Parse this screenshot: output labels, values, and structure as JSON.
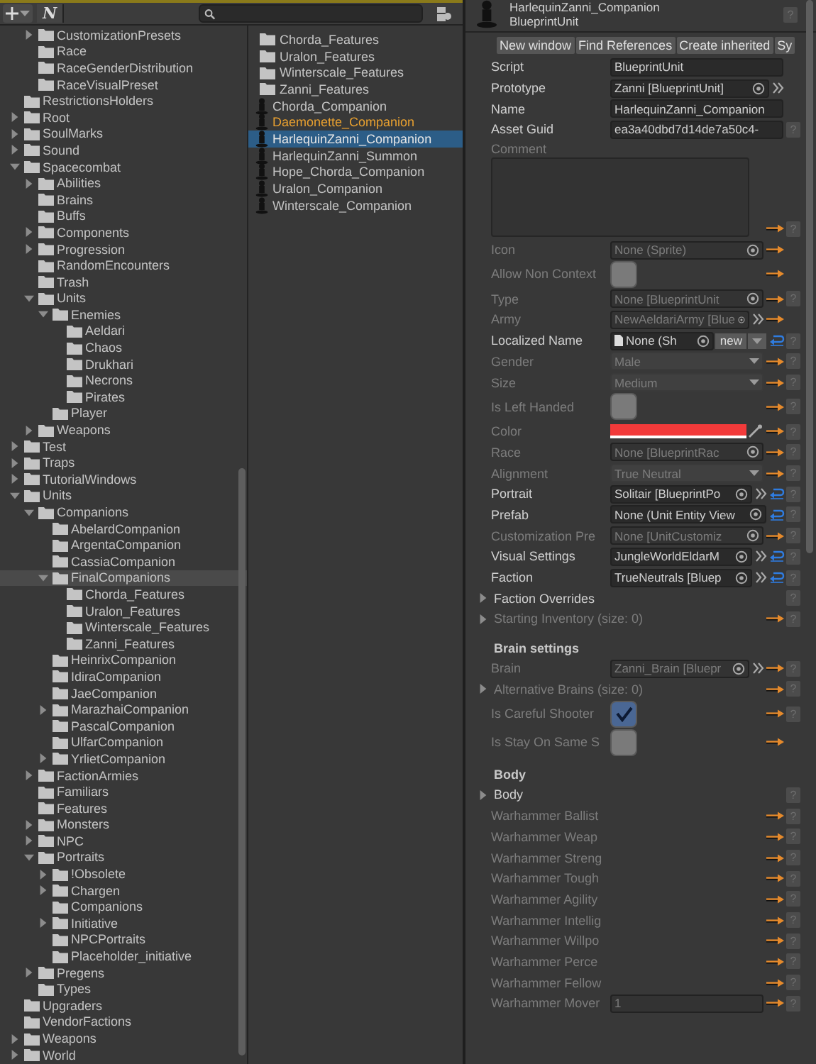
{
  "toolbar": {
    "logo": "N"
  },
  "tree": {
    "continued_items": [
      {
        "label": "CustomizationPresets",
        "expanded": false,
        "selected": false
      },
      {
        "label": "Race",
        "selected": false
      },
      {
        "label": "RaceGenderDistribution",
        "selected": false
      },
      {
        "label": "RaceVisualPreset",
        "selected": false
      }
    ],
    "items": [
      {
        "label": "RestrictionsHolders",
        "selected": false
      },
      {
        "label": "Root",
        "expanded": false,
        "selected": false
      },
      {
        "label": "SoulMarks",
        "expanded": false,
        "selected": false
      },
      {
        "label": "Sound",
        "expanded": false,
        "selected": false
      },
      {
        "label": "Spacecombat",
        "expanded": true,
        "selected": false,
        "children": [
          {
            "label": "Abilities",
            "expanded": false,
            "selected": false
          },
          {
            "label": "Brains",
            "selected": false
          },
          {
            "label": "Buffs",
            "selected": false
          },
          {
            "label": "Components",
            "expanded": false,
            "selected": false
          },
          {
            "label": "Progression",
            "expanded": false,
            "selected": false
          },
          {
            "label": "RandomEncounters",
            "selected": false
          },
          {
            "label": "Trash",
            "selected": false
          },
          {
            "label": "Units",
            "expanded": true,
            "selected": false,
            "children": [
              {
                "label": "Enemies",
                "expanded": true,
                "selected": false,
                "children": [
                  {
                    "label": "Aeldari",
                    "selected": false
                  },
                  {
                    "label": "Chaos",
                    "selected": false
                  },
                  {
                    "label": "Drukhari",
                    "selected": false
                  },
                  {
                    "label": "Necrons",
                    "selected": false
                  },
                  {
                    "label": "Pirates",
                    "selected": false
                  }
                ]
              },
              {
                "label": "Player",
                "selected": false
              }
            ]
          },
          {
            "label": "Weapons",
            "expanded": false,
            "selected": false
          }
        ]
      },
      {
        "label": "Test",
        "expanded": false,
        "selected": false
      },
      {
        "label": "Traps",
        "expanded": false,
        "selected": false
      },
      {
        "label": "TutorialWindows",
        "expanded": false,
        "selected": false
      },
      {
        "label": "Units",
        "expanded": true,
        "selected": false,
        "children": [
          {
            "label": "Companions",
            "expanded": true,
            "selected": false,
            "children": [
              {
                "label": "AbelardCompanion",
                "selected": false
              },
              {
                "label": "ArgentaCompanion",
                "selected": false
              },
              {
                "label": "CassiaCompanion",
                "selected": false
              },
              {
                "label": "FinalCompanions",
                "expanded": true,
                "selected": true,
                "children": [
                  {
                    "label": "Chorda_Features",
                    "selected": false
                  },
                  {
                    "label": "Uralon_Features",
                    "selected": false
                  },
                  {
                    "label": "Winterscale_Features",
                    "selected": false
                  },
                  {
                    "label": "Zanni_Features",
                    "selected": false
                  }
                ]
              },
              {
                "label": "HeinrixCompanion",
                "selected": false
              },
              {
                "label": "IdiraCompanion",
                "selected": false
              },
              {
                "label": "JaeCompanion",
                "selected": false
              },
              {
                "label": "MarazhaiCompanion",
                "expanded": false,
                "selected": false
              },
              {
                "label": "PascalCompanion",
                "selected": false
              },
              {
                "label": "UlfarCompanion",
                "selected": false
              },
              {
                "label": "YrlietCompanion",
                "expanded": false,
                "selected": false
              }
            ]
          },
          {
            "label": "FactionArmies",
            "expanded": false,
            "selected": false
          },
          {
            "label": "Familiars",
            "selected": false
          },
          {
            "label": "Features",
            "selected": false
          },
          {
            "label": "Monsters",
            "expanded": false,
            "selected": false
          },
          {
            "label": "NPC",
            "expanded": false,
            "selected": false
          },
          {
            "label": "Portraits",
            "expanded": true,
            "selected": false,
            "children": [
              {
                "label": "!Obsolete",
                "expanded": false,
                "selected": false
              },
              {
                "label": "Chargen",
                "expanded": false,
                "selected": false
              },
              {
                "label": "Companions",
                "selected": false
              },
              {
                "label": "Initiative",
                "expanded": false,
                "selected": false
              },
              {
                "label": "NPCPortraits",
                "selected": false
              },
              {
                "label": "Placeholder_initiative",
                "selected": false
              }
            ]
          },
          {
            "label": "Pregens",
            "expanded": false,
            "selected": false
          },
          {
            "label": "Types",
            "selected": false
          }
        ]
      },
      {
        "label": "Upgraders",
        "selected": false
      },
      {
        "label": "VendorFactions",
        "selected": false
      },
      {
        "label": "Weapons",
        "expanded": false,
        "selected": false
      },
      {
        "label": "World",
        "expanded": false,
        "selected": false
      }
    ]
  },
  "list": {
    "items": [
      {
        "kind": "folder",
        "label": "Chorda_Features",
        "color": "#c4c4c4",
        "selected": false
      },
      {
        "kind": "folder",
        "label": "Uralon_Features",
        "color": "#c4c4c4",
        "selected": false
      },
      {
        "kind": "folder",
        "label": "Winterscale_Features",
        "color": "#c4c4c4",
        "selected": false
      },
      {
        "kind": "folder",
        "label": "Zanni_Features",
        "color": "#c4c4c4",
        "selected": false
      },
      {
        "kind": "asset",
        "label": "Chorda_Companion",
        "color": "#c4c4c4",
        "selected": false
      },
      {
        "kind": "asset",
        "label": "Daemonette_Companion",
        "color": "#e8a030",
        "selected": false
      },
      {
        "kind": "asset",
        "label": "HarlequinZanni_Companion",
        "color": "#e6e6e6",
        "selected": true
      },
      {
        "kind": "asset",
        "label": "HarlequinZanni_Summon",
        "color": "#c4c4c4",
        "selected": false
      },
      {
        "kind": "asset",
        "label": "Hope_Chorda_Companion",
        "color": "#c4c4c4",
        "selected": false
      },
      {
        "kind": "asset",
        "label": "Uralon_Companion",
        "color": "#c4c4c4",
        "selected": false
      },
      {
        "kind": "asset",
        "label": "Winterscale_Companion",
        "color": "#c4c4c4",
        "selected": false
      }
    ]
  },
  "inspector": {
    "title": "HarlequinZanni_Companion",
    "type": "BlueprintUnit",
    "help": "?",
    "buttons": [
      "New window",
      "Find References",
      "Create inherited",
      "Sy"
    ],
    "rows": [
      {
        "kind": "text",
        "label": "Script",
        "value": "BlueprintUnit",
        "disabled": false,
        "override": false,
        "jump": false,
        "revert": false
      },
      {
        "kind": "object",
        "label": "Prototype",
        "value": "Zanni [BlueprintUnit]",
        "disabled": false,
        "override": false,
        "jump": true,
        "revert": false
      },
      {
        "kind": "text",
        "label": "Name",
        "value": "HarlequinZanni_Companion",
        "disabled": false,
        "override": false,
        "jump": false,
        "revert": false
      },
      {
        "kind": "text",
        "label": "Asset Guid",
        "value": "ea3a40dbd7d14de7a50c4-",
        "disabled": false,
        "override": false,
        "jump": false,
        "revert": false,
        "help": "?"
      },
      {
        "kind": "textarea",
        "label": "Comment",
        "disabled": true,
        "override": true,
        "jump": false,
        "revert": false,
        "help": "?"
      },
      {
        "kind": "object",
        "label": "Icon",
        "value": "None (Sprite)",
        "disabled": true,
        "override": true,
        "jump": false,
        "revert": false
      },
      {
        "kind": "toggle",
        "label": "Allow Non Context",
        "checked": false,
        "disabled": true,
        "override": true,
        "jump": false,
        "revert": false
      },
      {
        "kind": "object",
        "label": "Type",
        "value": "None [BlueprintUnit",
        "disabled": true,
        "override": true,
        "jump": false,
        "revert": false,
        "help": "?"
      },
      {
        "kind": "object",
        "label": "Army",
        "value": "NewAeldariArmy [Blue",
        "disabled": true,
        "override": true,
        "jump": true,
        "revert": false
      },
      {
        "kind": "localized",
        "label": "Localized Name",
        "value": "None (Sh",
        "button": "new",
        "disabled": false,
        "override": false,
        "jump": false,
        "revert": true,
        "help": "?"
      },
      {
        "kind": "dropdown",
        "label": "Gender",
        "value": "Male",
        "disabled": true,
        "override": true,
        "jump": false,
        "revert": false,
        "help": "?"
      },
      {
        "kind": "dropdown",
        "label": "Size",
        "value": "Medium",
        "disabled": true,
        "override": true,
        "jump": false,
        "revert": false,
        "help": "?"
      },
      {
        "kind": "toggle",
        "label": "Is Left Handed",
        "checked": false,
        "disabled": true,
        "override": true,
        "jump": false,
        "revert": false,
        "help": "?"
      },
      {
        "kind": "color",
        "label": "Color",
        "color": "#f23a3a",
        "disabled": true,
        "override": true,
        "jump": false,
        "revert": false,
        "help": "?"
      },
      {
        "kind": "object",
        "label": "Race",
        "value": "None [BlueprintRac",
        "disabled": true,
        "override": true,
        "jump": false,
        "revert": false,
        "help": "?"
      },
      {
        "kind": "dropdown",
        "label": "Alignment",
        "value": "True Neutral",
        "disabled": true,
        "override": true,
        "jump": false,
        "revert": false,
        "help": "?"
      },
      {
        "kind": "object",
        "label": "Portrait",
        "value": "Solitair [BlueprintPo",
        "disabled": false,
        "override": false,
        "jump": true,
        "revert": true,
        "help": "?"
      },
      {
        "kind": "object",
        "label": "Prefab",
        "value": "None (Unit Entity View",
        "disabled": false,
        "override": false,
        "jump": false,
        "revert": true,
        "help": "?"
      },
      {
        "kind": "object",
        "label": "Customization Pre",
        "value": "None [UnitCustomiz",
        "disabled": true,
        "override": true,
        "jump": false,
        "revert": false,
        "help": "?"
      },
      {
        "kind": "object",
        "label": "Visual Settings",
        "value": "JungleWorldEldarM",
        "disabled": false,
        "override": false,
        "jump": true,
        "revert": true,
        "help": "?"
      },
      {
        "kind": "object",
        "label": "Faction",
        "value": "TrueNeutrals [Bluep",
        "disabled": false,
        "override": false,
        "jump": true,
        "revert": true,
        "help": "?"
      },
      {
        "kind": "foldout",
        "label": "Faction Overrides",
        "expanded": false,
        "disabled": false,
        "override": false,
        "jump": false,
        "revert": false,
        "help": "?"
      },
      {
        "kind": "foldout",
        "label": "Starting Inventory (size: 0)",
        "expanded": false,
        "disabled": true,
        "override": true,
        "jump": false,
        "revert": false,
        "help": "?"
      },
      {
        "kind": "header",
        "label": "Brain settings"
      },
      {
        "kind": "object",
        "label": "Brain",
        "value": "Zanni_Brain [Bluepr",
        "disabled": true,
        "override": true,
        "jump": true,
        "revert": false,
        "help": "?"
      },
      {
        "kind": "foldout",
        "label": "Alternative Brains (size: 0)",
        "expanded": false,
        "disabled": true,
        "override": true,
        "jump": false,
        "revert": false,
        "help": "?"
      },
      {
        "kind": "toggle",
        "label": "Is Careful Shooter",
        "checked": true,
        "disabled": true,
        "override": true,
        "jump": false,
        "revert": false,
        "help": "?"
      },
      {
        "kind": "toggle",
        "label": "Is Stay On Same S",
        "checked": false,
        "disabled": true,
        "override": true,
        "jump": false,
        "revert": false
      },
      {
        "kind": "header",
        "label": "Body"
      },
      {
        "kind": "foldout",
        "label": "Body",
        "expanded": false,
        "disabled": false,
        "override": false,
        "jump": false,
        "revert": false,
        "help": "?"
      },
      {
        "kind": "label",
        "label": "Warhammer Ballist",
        "disabled": true,
        "override": true,
        "jump": false,
        "revert": false,
        "help": "?"
      },
      {
        "kind": "label",
        "label": "Warhammer Weap",
        "disabled": true,
        "override": true,
        "jump": false,
        "revert": false,
        "help": "?"
      },
      {
        "kind": "label",
        "label": "Warhammer Streng",
        "disabled": true,
        "override": true,
        "jump": false,
        "revert": false,
        "help": "?"
      },
      {
        "kind": "label",
        "label": "Warhammer Tough",
        "disabled": true,
        "override": true,
        "jump": false,
        "revert": false,
        "help": "?"
      },
      {
        "kind": "label",
        "label": "Warhammer Agility",
        "disabled": true,
        "override": true,
        "jump": false,
        "revert": false,
        "help": "?"
      },
      {
        "kind": "label",
        "label": "Warhammer Intellig",
        "disabled": true,
        "override": true,
        "jump": false,
        "revert": false,
        "help": "?"
      },
      {
        "kind": "label",
        "label": "Warhammer Willpo",
        "disabled": true,
        "override": true,
        "jump": false,
        "revert": false,
        "help": "?"
      },
      {
        "kind": "label",
        "label": "Warhammer Perce",
        "disabled": true,
        "override": true,
        "jump": false,
        "revert": false,
        "help": "?"
      },
      {
        "kind": "label",
        "label": "Warhammer Fellow",
        "disabled": true,
        "override": true,
        "jump": false,
        "revert": false,
        "help": "?"
      },
      {
        "kind": "text",
        "label": "Warhammer Mover",
        "value": "1",
        "disabled": true,
        "override": true,
        "jump": false,
        "revert": false,
        "help": "?"
      }
    ]
  }
}
